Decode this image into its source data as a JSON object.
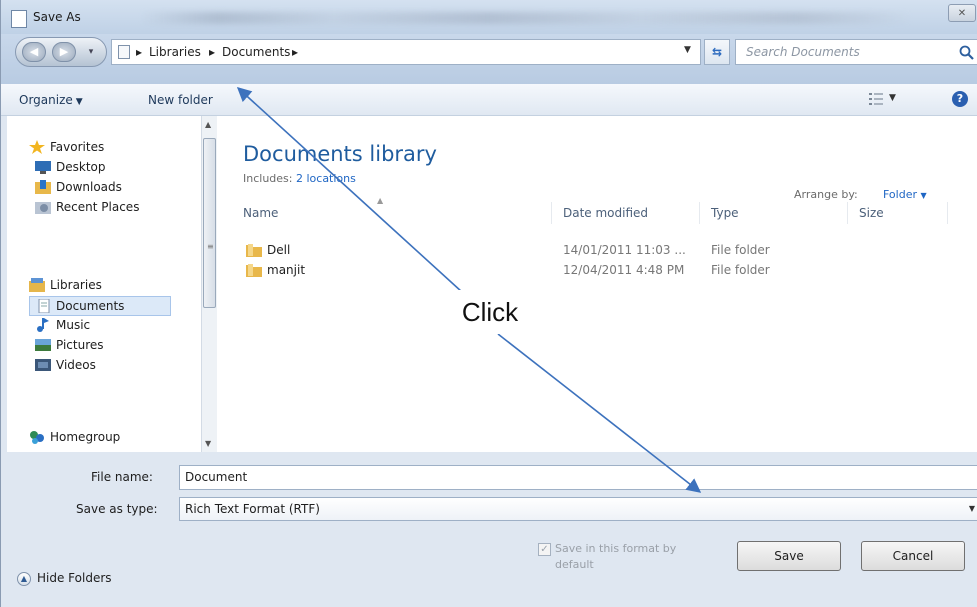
{
  "window": {
    "title": "Save As",
    "close_label": "✕"
  },
  "address": {
    "crumbs": [
      "Libraries",
      "Documents"
    ],
    "separator": "▸",
    "search_placeholder": "Search Documents"
  },
  "toolbar": {
    "organize": "Organize",
    "new_folder": "New folder"
  },
  "nav": {
    "favorites": "Favorites",
    "desktop": "Desktop",
    "downloads": "Downloads",
    "recent_places": "Recent Places",
    "libraries": "Libraries",
    "documents": "Documents",
    "music": "Music",
    "pictures": "Pictures",
    "videos": "Videos",
    "homegroup": "Homegroup"
  },
  "library": {
    "title": "Documents library",
    "includes_label": "Includes:",
    "includes_link": "2 locations",
    "arrange_label": "Arrange by:",
    "arrange_value": "Folder"
  },
  "columns": {
    "name": "Name",
    "date_modified": "Date modified",
    "type": "Type",
    "size": "Size"
  },
  "files": [
    {
      "name": "Dell",
      "date": "14/01/2011 11:03 ...",
      "type": "File folder"
    },
    {
      "name": "manjit",
      "date": "12/04/2011 4:48 PM",
      "type": "File folder"
    }
  ],
  "form": {
    "file_name_label": "File name:",
    "file_name_value": "Document",
    "save_type_label": "Save as type:",
    "save_type_value": "Rich Text Format (RTF)",
    "default_checkbox_label": "Save in this format by default",
    "save_button": "Save",
    "cancel_button": "Cancel",
    "hide_folders": "Hide Folders"
  },
  "annotation": {
    "label": "Click",
    "color": "#3d72bd"
  },
  "colors": {
    "accent": "#1f5c9e",
    "link": "#1f66c4"
  }
}
